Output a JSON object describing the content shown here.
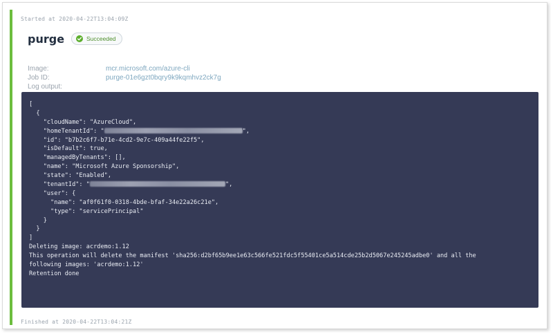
{
  "job": {
    "started": "Started at 2020-04-22T13:04:09Z",
    "title": "purge",
    "status": "Succeeded",
    "finished": "Finished at 2020-04-22T13:04:21Z"
  },
  "meta": {
    "image_label": "Image:",
    "image_value": "mcr.microsoft.com/azure-cli",
    "jobid_label": "Job ID:",
    "jobid_value": "purge-01e6gzt0bqry9k9kqmhvz2ck7g",
    "log_label": "Log output:"
  },
  "log": {
    "lines": [
      "[",
      "  {",
      "    \"cloudName\": \"AzureCloud\",",
      "    \"homeTenantId\": \"",
      "\",",
      "    \"id\": \"b7b2c6f7-b71e-4cd2-9e7c-409a44fe22f5\",",
      "    \"isDefault\": true,",
      "    \"managedByTenants\": [],",
      "    \"name\": \"Microsoft Azure Sponsorship\",",
      "    \"state\": \"Enabled\",",
      "    \"tenantId\": \"",
      "\",",
      "    \"user\": {",
      "      \"name\": \"af0f61f0-0318-4bde-bfaf-34e22a26c21e\",",
      "      \"type\": \"servicePrincipal\"",
      "    }",
      "  }",
      "]",
      "Deleting image: acrdemo:1.12",
      "This operation will delete the manifest 'sha256:d2bf65b9ee1e63c566fe521fdc5f55401ce5a514cde25b2d5067e245245adbe0' and all the",
      "following images: 'acrdemo:1.12'",
      "Retention done"
    ]
  },
  "colors": {
    "accent_green": "#6cbd3e",
    "log_background": "#353a56",
    "link_blue": "#7ea7bf"
  }
}
